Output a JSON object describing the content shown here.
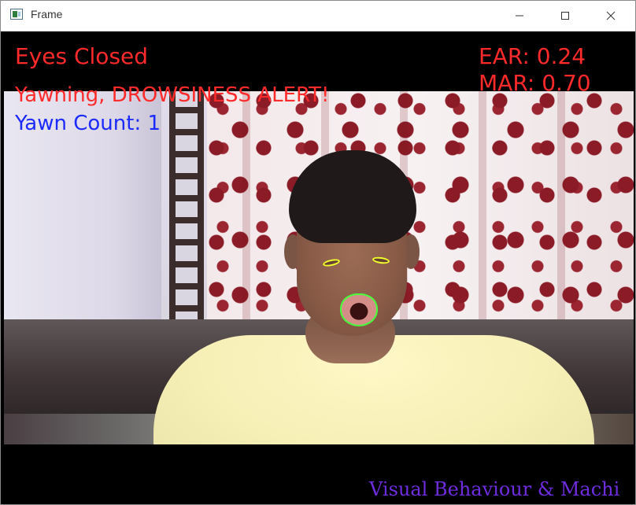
{
  "window": {
    "title": "Frame",
    "icons": {
      "app": "app-icon",
      "minimize": "minimize-icon",
      "maximize": "maximize-icon",
      "close": "close-icon"
    }
  },
  "overlay": {
    "status_eyes": "Eyes Closed",
    "status_yawn": "Yawning, DROWSINESS ALERT!",
    "yawn_count": "Yawn Count: 1",
    "ear": "EAR: 0.24",
    "mar": "MAR: 0.70",
    "caption": "Visual Behaviour & Machi"
  },
  "colors": {
    "alert": "#ff2a2a",
    "count": "#1b2aff",
    "eye_contour": "#f1ff2a",
    "mouth_contour": "#47ff3a",
    "caption": "#6f2ce0"
  }
}
